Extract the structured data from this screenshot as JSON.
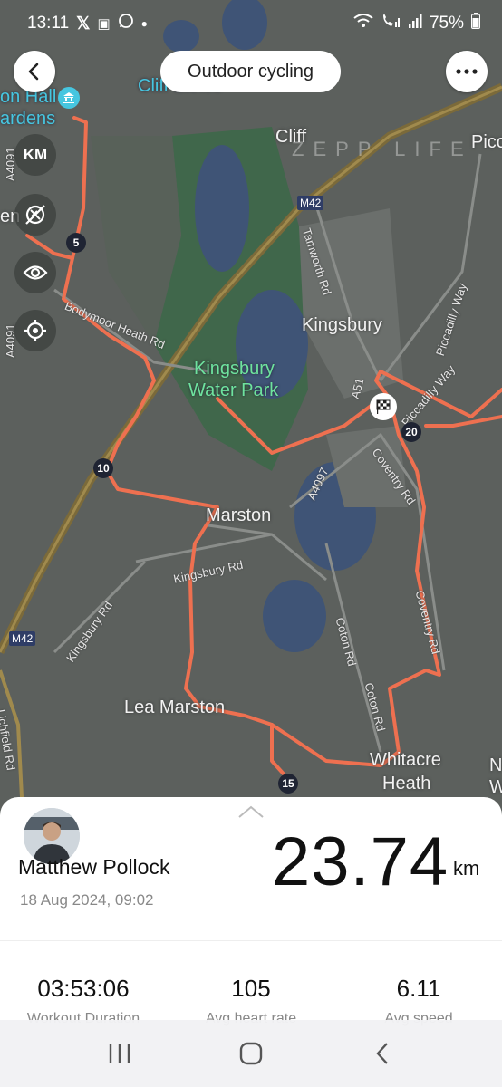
{
  "status_bar": {
    "time": "13:11",
    "battery": "75%",
    "icons": [
      "x-icon",
      "book-icon",
      "whatsapp-icon",
      "dot-icon",
      "wifi-icon",
      "call-signal-icon",
      "signal-icon",
      "battery-icon"
    ]
  },
  "header": {
    "title": "Outdoor cycling",
    "back_icon": "back-arrow-icon",
    "more_icon": "more-options-icon"
  },
  "map_controls": {
    "unit_label": "KM",
    "icons": [
      "no-satellite-icon",
      "eye-icon",
      "locate-icon"
    ]
  },
  "map": {
    "watermark": "ZEPP LIFE",
    "places": [
      "Cliff",
      "Kingsbury",
      "Marston",
      "Lea Marston",
      "Whitacre",
      "Heath",
      "Piccad",
      "N",
      "W"
    ],
    "park": [
      "Kingsbury",
      "Water Park"
    ],
    "poi": [
      "on Hall",
      "ardens",
      "Cliff Lakes"
    ],
    "roads": [
      "Bodymoor Heath Rd",
      "Tamworth Rd",
      "Piccadilly Way",
      "Piccadilly Way",
      "A51",
      "Coventry Rd",
      "Coventry Rd",
      "A4097",
      "Kingsbury Rd",
      "Kingsbury Rd",
      "Coton Rd",
      "Coton Rd",
      "Lichfield Rd",
      "A4091",
      "A4091",
      "en"
    ],
    "motorway": [
      "M42",
      "M42"
    ],
    "km_markers": [
      "5",
      "10",
      "15",
      "20"
    ],
    "route_color": "#ee7050"
  },
  "workout": {
    "user_name": "Matthew Pollock",
    "date": "18 Aug 2024, 09:02",
    "distance": "23.74",
    "distance_unit": "km",
    "stats": [
      {
        "value": "03:53:06",
        "label": "Workout Duration"
      },
      {
        "value": "105",
        "label": "Avg heart rate"
      },
      {
        "value": "6.11",
        "label": "Avg speed"
      }
    ]
  },
  "nav_bar": {
    "icons": [
      "recent-apps-icon",
      "home-icon",
      "back-icon"
    ]
  }
}
